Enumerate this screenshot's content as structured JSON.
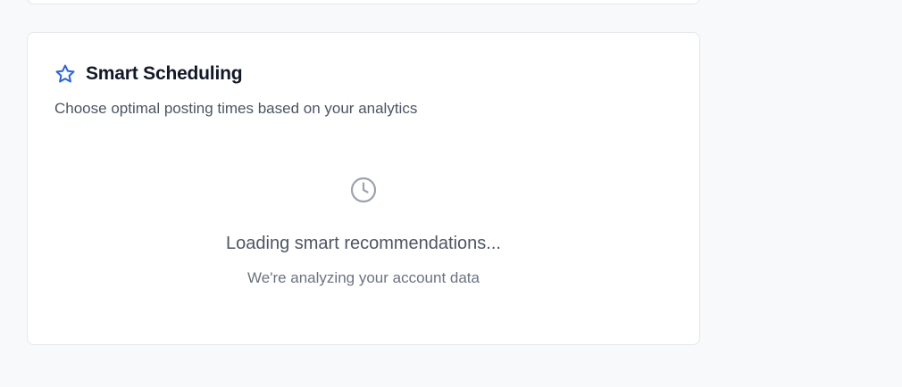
{
  "smart_scheduling": {
    "icon": "star-icon",
    "title": "Smart Scheduling",
    "subtitle": "Choose optimal posting times based on your analytics",
    "loading": {
      "icon": "clock-icon",
      "title": "Loading smart recommendations...",
      "subtitle": "We're analyzing your account data"
    }
  },
  "colors": {
    "accent": "#2563eb",
    "muted_icon": "#9ca3af",
    "background": "#f8f9fb",
    "card": "#ffffff"
  }
}
